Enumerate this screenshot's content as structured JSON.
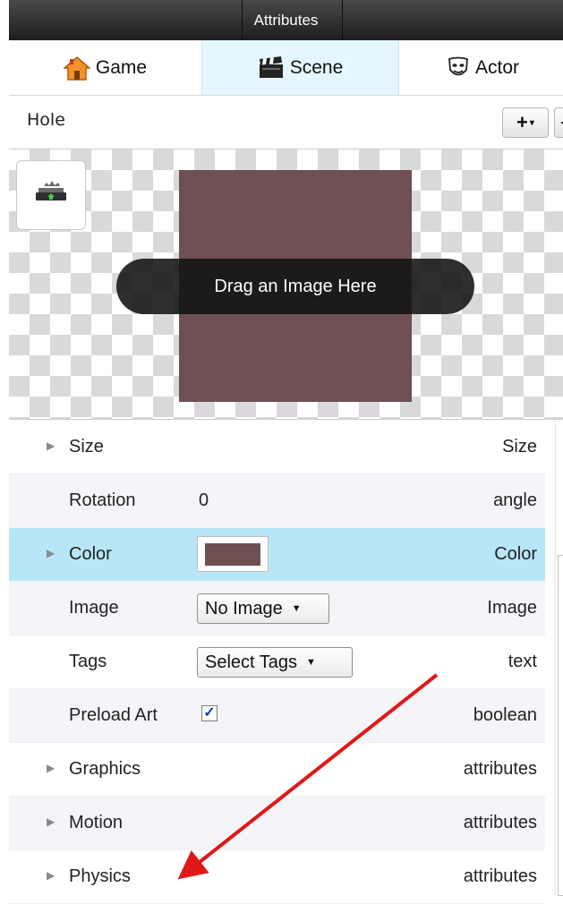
{
  "window": {
    "title": "Attributes"
  },
  "tabs": [
    {
      "label": "Game",
      "icon": "home-icon"
    },
    {
      "label": "Scene",
      "icon": "clapperboard-icon"
    },
    {
      "label": "Actor",
      "icon": "theater-mask-icon"
    }
  ],
  "actor": {
    "name": "Hole"
  },
  "toolbar": {
    "add_label": "+",
    "add_caret": "▾",
    "remove_label": "-"
  },
  "preview": {
    "drop_hint": "Drag an Image Here",
    "color": "#6e5052",
    "upload_icon": "upload-tray-icon"
  },
  "attributes": [
    {
      "label": "Size",
      "type": "Size",
      "expandable": true
    },
    {
      "label": "Rotation",
      "value": "0",
      "type": "angle"
    },
    {
      "label": "Color",
      "type": "Color",
      "expandable": true,
      "selected": true,
      "color": "#6e5052"
    },
    {
      "label": "Image",
      "select": "No Image",
      "type": "Image"
    },
    {
      "label": "Tags",
      "select": "Select Tags",
      "type": "text"
    },
    {
      "label": "Preload Art",
      "checked": true,
      "check_mark": "✓",
      "type": "boolean"
    },
    {
      "label": "Graphics",
      "type": "attributes",
      "expandable": true
    },
    {
      "label": "Motion",
      "type": "attributes",
      "expandable": true
    },
    {
      "label": "Physics",
      "type": "attributes",
      "expandable": true
    }
  ],
  "colors": {
    "selected_row": "#b7e6f6",
    "alt_row": "#f4f5f9",
    "scene_tab": "#e4f6ff",
    "annotation_arrow": "#e01818"
  }
}
